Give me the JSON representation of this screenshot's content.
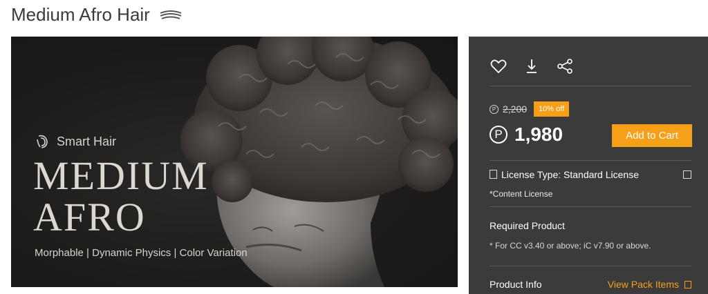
{
  "page": {
    "title": "Medium Afro Hair",
    "title_icon": "hair-icon"
  },
  "banner": {
    "brand": "Smart Hair",
    "headline_line1": "MEDIUM",
    "headline_line2": "AFRO",
    "features": "Morphable | Dynamic Physics | Color Variation"
  },
  "panel": {
    "icons": [
      "heart-icon",
      "download-icon",
      "share-icon"
    ],
    "currency_symbol": "P",
    "original_price": "2,200",
    "discount_badge": "10% off",
    "price": "1,980",
    "add_to_cart": "Add to Cart",
    "license_type": "License Type: Standard License",
    "license_sub": "*Content License",
    "required_title": "Required Product",
    "required_text": "* For CC v3.40 or above; iC v7.90 or above.",
    "product_info": "Product Info",
    "view_pack": "View Pack Items"
  },
  "colors": {
    "accent": "#f6a01a",
    "panel_bg": "#3b3b3b",
    "banner_bg": "#1d1c1b"
  }
}
